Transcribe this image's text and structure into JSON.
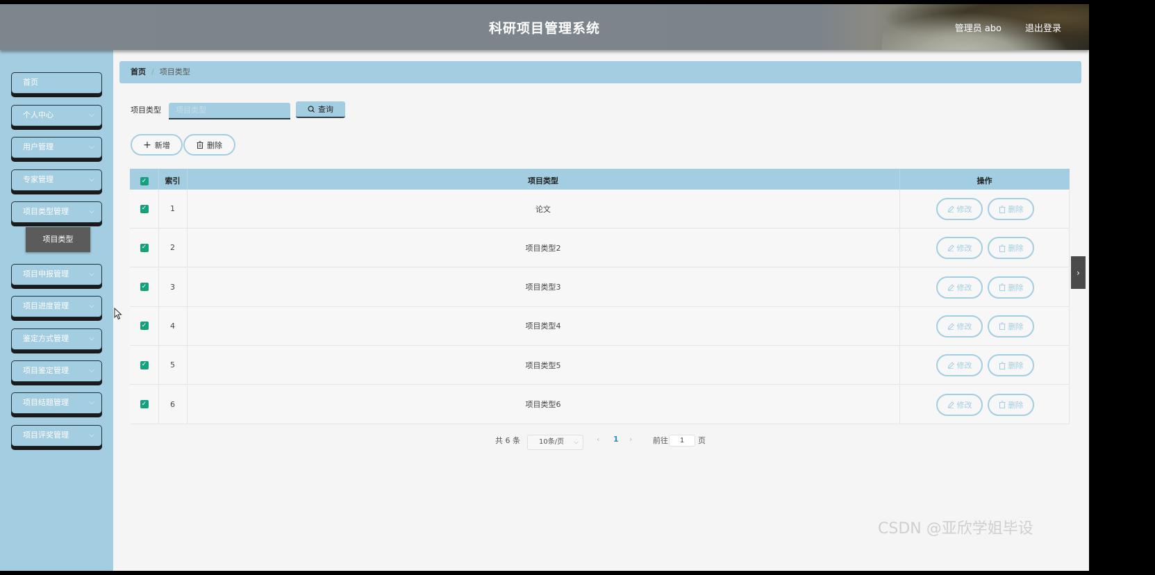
{
  "header": {
    "title": "科研项目管理系统",
    "user": "管理员 abo",
    "logout": "退出登录"
  },
  "sidebar": {
    "items": [
      {
        "label": "首页",
        "has_chevron": false
      },
      {
        "label": "个人中心",
        "has_chevron": true
      },
      {
        "label": "用户管理",
        "has_chevron": true
      },
      {
        "label": "专家管理",
        "has_chevron": true
      },
      {
        "label": "项目类型管理",
        "has_chevron": true
      },
      {
        "label": "项目申报管理",
        "has_chevron": true
      },
      {
        "label": "项目进度管理",
        "has_chevron": true
      },
      {
        "label": "鉴定方式管理",
        "has_chevron": true
      },
      {
        "label": "项目鉴定管理",
        "has_chevron": true
      },
      {
        "label": "项目结题管理",
        "has_chevron": true
      },
      {
        "label": "项目评奖管理",
        "has_chevron": true
      }
    ],
    "active_sub": "项目类型"
  },
  "breadcrumb": {
    "home": "首页",
    "separator": "/",
    "current": "项目类型"
  },
  "search": {
    "label": "项目类型",
    "placeholder": "项目类型",
    "value": "",
    "button": "查询"
  },
  "actions": {
    "add": "新增",
    "delete": "删除"
  },
  "table": {
    "headers": {
      "index": "索引",
      "type": "项目类型",
      "ops": "操作"
    },
    "rows": [
      {
        "index": "1",
        "type": "论文",
        "checked": true
      },
      {
        "index": "2",
        "type": "项目类型2",
        "checked": true
      },
      {
        "index": "3",
        "type": "项目类型3",
        "checked": true
      },
      {
        "index": "4",
        "type": "项目类型4",
        "checked": true
      },
      {
        "index": "5",
        "type": "项目类型5",
        "checked": true
      },
      {
        "index": "6",
        "type": "项目类型6",
        "checked": true
      }
    ],
    "row_edit": "修改",
    "row_delete": "删除"
  },
  "pagination": {
    "total": "共 6 条",
    "page_size": "10条/页",
    "current_page": "1",
    "goto_label": "前往",
    "goto_value": "1",
    "page_unit": "页"
  },
  "watermark": "CSDN @亚欣学姐毕设",
  "colors": {
    "accent": "#a3cde0",
    "checkbox": "#17a07e",
    "submenu_active": "#5b5b5b"
  }
}
